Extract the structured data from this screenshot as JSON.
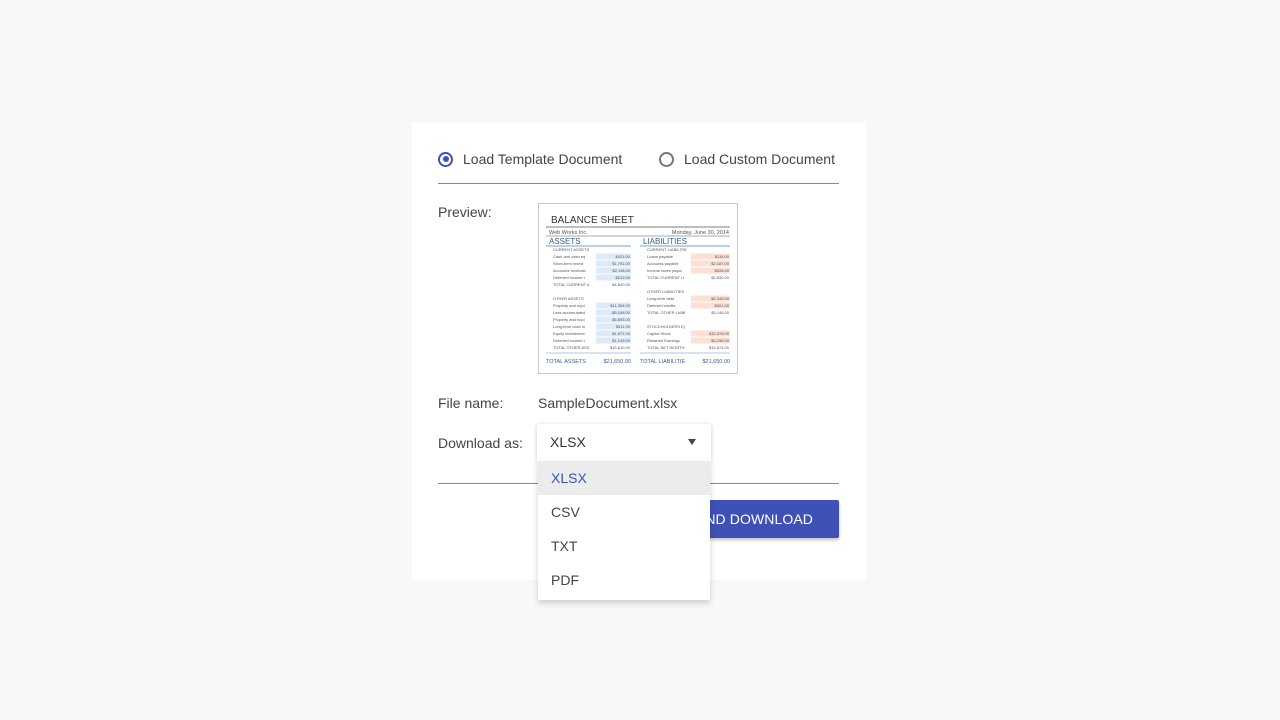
{
  "load_options": {
    "template_label": "Load Template Document",
    "template_checked": true,
    "custom_label": "Load Custom Document",
    "custom_checked": false
  },
  "preview": {
    "label": "Preview:",
    "thumbnail": {
      "title": "BALANCE SHEET",
      "company": "Web Works Inc.",
      "date": "Monday, June 30, 2014",
      "assets_heading": "ASSETS",
      "liabilities_heading": "LIABILITIES",
      "assets_rows": [
        {
          "label": "CURRENT ASSETS",
          "value": ""
        },
        {
          "label": "Cash and cash eq",
          "value": "$421.00"
        },
        {
          "label": "Short-term invest",
          "value": "$1,791.00"
        },
        {
          "label": "Accounts receivab",
          "value": "$2,118.00"
        },
        {
          "label": "Deferred income t",
          "value": "$512.00"
        },
        {
          "label": "TOTAL CURRENT A",
          "value": "$4,840.00"
        },
        {
          "label": "",
          "value": ""
        },
        {
          "label": "OTHER ASSETS",
          "value": ""
        },
        {
          "label": "Property and equi",
          "value": "$11,354.00"
        },
        {
          "label": "Less accumulated",
          "value": "-$5,108.00"
        },
        {
          "label": "Property and equi",
          "value": "$6,805.00"
        },
        {
          "label": "Long-term cash in",
          "value": "$511.00"
        },
        {
          "label": "Equity investment",
          "value": "$1,971.00"
        },
        {
          "label": "Deferred income t",
          "value": "$1,145.00"
        },
        {
          "label": "TOTAL OTHER ASS",
          "value": "$16,810.00"
        }
      ],
      "liabilities_rows": [
        {
          "label": "CURRENT LIABILITIE",
          "value": ""
        },
        {
          "label": "Loans payable",
          "value": "$115.00"
        },
        {
          "label": "Accounts payable",
          "value": "$2,187.00"
        },
        {
          "label": "Income taxes payal",
          "value": "$528.00"
        },
        {
          "label": "TOTAL CURRENT LI",
          "value": "$2,830.00"
        },
        {
          "label": "",
          "value": ""
        },
        {
          "label": "OTHER LIABILITIES",
          "value": ""
        },
        {
          "label": "Long-term debt",
          "value": "$2,345.00"
        },
        {
          "label": "Deferred credits",
          "value": "$801.00"
        },
        {
          "label": "TOTAL OTHER LIABI",
          "value": "$3,146.00"
        },
        {
          "label": "",
          "value": ""
        },
        {
          "label": "STOCKHOLDERS E(",
          "value": ""
        },
        {
          "label": "Capital Stock",
          "value": "$12,378.00"
        },
        {
          "label": "Retained Earnings",
          "value": "$3,296.00"
        },
        {
          "label": "TOTAL NET WORTH",
          "value": "$15,674.00"
        }
      ],
      "total_assets_label": "TOTAL ASSETS",
      "total_assets_value": "$21,650.00",
      "total_liabilities_label": "TOTAL LIABILITIE",
      "total_liabilities_value": "$21,650.00"
    }
  },
  "file": {
    "label": "File name:",
    "name": "SampleDocument.xlsx"
  },
  "download": {
    "label": "Download as:",
    "selected": "XLSX",
    "options": [
      "XLSX",
      "CSV",
      "TXT",
      "PDF"
    ],
    "button_label": "ND DOWNLOAD"
  },
  "colors": {
    "accent": "#3f51b5",
    "assets_fill": "#ddeaf7",
    "liabilities_fill": "#fbe0d3",
    "heading_line": "#8fb4dd"
  }
}
